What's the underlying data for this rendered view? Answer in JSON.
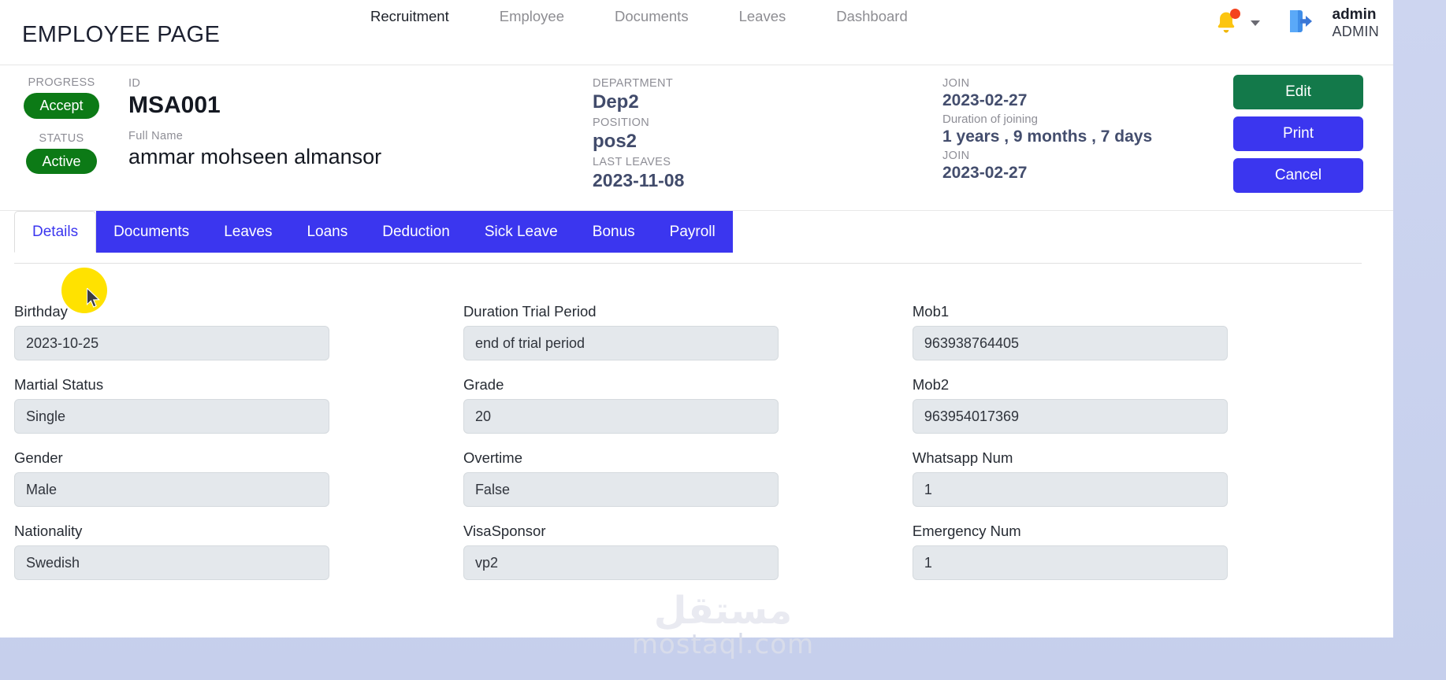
{
  "header": {
    "page_title": "EMPLOYEE PAGE",
    "nav": [
      {
        "label": "Recruitment",
        "active": true
      },
      {
        "label": "Employee",
        "active": false
      },
      {
        "label": "Documents",
        "active": false
      },
      {
        "label": "Leaves",
        "active": false
      },
      {
        "label": "Dashboard",
        "active": false
      }
    ],
    "notification_icon": "bell-icon",
    "notification_has_alert": true,
    "dropdown_icon": "chevron-down-icon",
    "account_icon": "logout-icon",
    "user_name": "admin",
    "user_role": "ADMIN"
  },
  "info": {
    "progress_label": "PROGRESS",
    "progress_value": "Accept",
    "status_label": "STATUS",
    "status_value": "Active",
    "id_label": "ID",
    "id_value": "MSA001",
    "fullname_label": "Full Name",
    "fullname_value": "ammar mohseen almansor",
    "department_label": "DEPARTMENT",
    "department_value": "Dep2",
    "position_label": "POSITION",
    "position_value": "pos2",
    "last_leaves_label": "LAST LEAVES",
    "last_leaves_value": "2023-11-08",
    "join_label": "JOIN",
    "join_value": "2023-02-27",
    "duration_label": "Duration of joining",
    "duration_value": "1 years , 9 months , 7 days",
    "join2_label": "JOIN",
    "join2_value": "2023-02-27"
  },
  "actions": {
    "edit": "Edit",
    "print": "Print",
    "cancel": "Cancel",
    "edit_color": "#13794a",
    "print_color": "#3b36ef",
    "cancel_color": "#3b36ef"
  },
  "tabs": [
    {
      "label": "Details",
      "active": true
    },
    {
      "label": "Documents",
      "active": false
    },
    {
      "label": "Leaves",
      "active": false
    },
    {
      "label": "Loans",
      "active": false
    },
    {
      "label": "Deduction",
      "active": false
    },
    {
      "label": "Sick Leave",
      "active": false
    },
    {
      "label": "Bonus",
      "active": false
    },
    {
      "label": "Payroll",
      "active": false
    }
  ],
  "form": {
    "col1": [
      {
        "label": "Birthday",
        "value": "2023-10-25"
      },
      {
        "label": "Martial Status",
        "value": "Single"
      },
      {
        "label": "Gender",
        "value": "Male"
      },
      {
        "label": "Nationality",
        "value": "Swedish"
      }
    ],
    "col2": [
      {
        "label": "Duration Trial Period",
        "value": "end of trial period"
      },
      {
        "label": "Grade",
        "value": "20"
      },
      {
        "label": "Overtime",
        "value": "False"
      },
      {
        "label": "VisaSponsor",
        "value": "vp2"
      }
    ],
    "col3": [
      {
        "label": "Mob1",
        "value": "963938764405"
      },
      {
        "label": "Mob2",
        "value": "963954017369"
      },
      {
        "label": "Whatsapp Num",
        "value": "1"
      },
      {
        "label": "Emergency Num",
        "value": "1"
      }
    ]
  },
  "watermark": {
    "arabic": "مستقل",
    "domain": "mostaql.com"
  }
}
